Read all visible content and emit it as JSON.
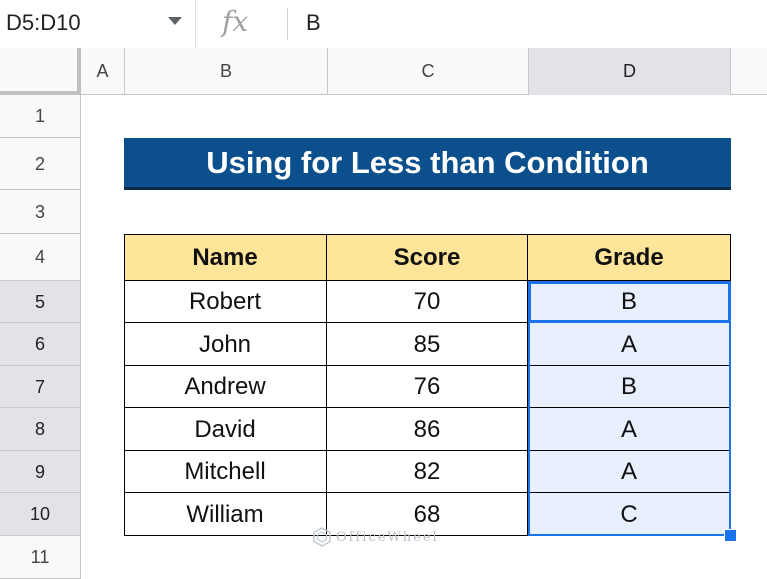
{
  "formula_bar": {
    "name_box": "D5:D10",
    "fx_symbol": "fx",
    "formula": "B"
  },
  "columns": [
    "A",
    "B",
    "C",
    "D"
  ],
  "rows": [
    "1",
    "2",
    "3",
    "4",
    "5",
    "6",
    "7",
    "8",
    "9",
    "10",
    "11"
  ],
  "title": "Using for Less than Condition",
  "table": {
    "headers": [
      "Name",
      "Score",
      "Grade"
    ],
    "rows": [
      {
        "name": "Robert",
        "score": "70",
        "grade": "B"
      },
      {
        "name": "John",
        "score": "85",
        "grade": "A"
      },
      {
        "name": "Andrew",
        "score": "76",
        "grade": "B"
      },
      {
        "name": "David",
        "score": "86",
        "grade": "A"
      },
      {
        "name": "Mitchell",
        "score": "82",
        "grade": "A"
      },
      {
        "name": "William",
        "score": "68",
        "grade": "C"
      }
    ]
  },
  "watermark": "OfficeWheel",
  "colors": {
    "title_bg": "#0b4f8c",
    "header_bg": "#ffe599",
    "selection": "#1a73e8",
    "selection_fill": "#e8f0fe"
  }
}
